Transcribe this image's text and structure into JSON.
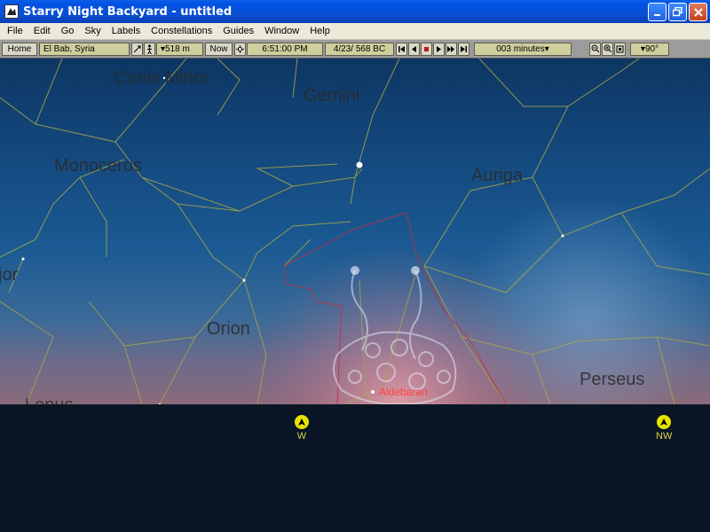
{
  "window": {
    "title": "Starry Night Backyard - untitled"
  },
  "menu": [
    "File",
    "Edit",
    "Go",
    "Sky",
    "Labels",
    "Constellations",
    "Guides",
    "Window",
    "Help"
  ],
  "toolbar": {
    "home_label": "Home",
    "location": "El Bab, Syria",
    "elevation": "▾518 m",
    "now_label": "Now",
    "time": "6:51:00 PM",
    "date": "4/23/  568 BC",
    "step": "003 minutes▾",
    "fov": "▾90°"
  },
  "sky": {
    "constellations": [
      {
        "name": "Canis Minor"
      },
      {
        "name": "Gemini"
      },
      {
        "name": "Monoceros"
      },
      {
        "name": "Auriga"
      },
      {
        "name": "Orion"
      },
      {
        "name": "Perseus"
      },
      {
        "name": "jor"
      },
      {
        "name": "Lepus"
      }
    ],
    "star_labels": [
      {
        "name": "Aldebaran"
      }
    ]
  },
  "compass": [
    {
      "label": "W"
    },
    {
      "label": "NW"
    }
  ]
}
